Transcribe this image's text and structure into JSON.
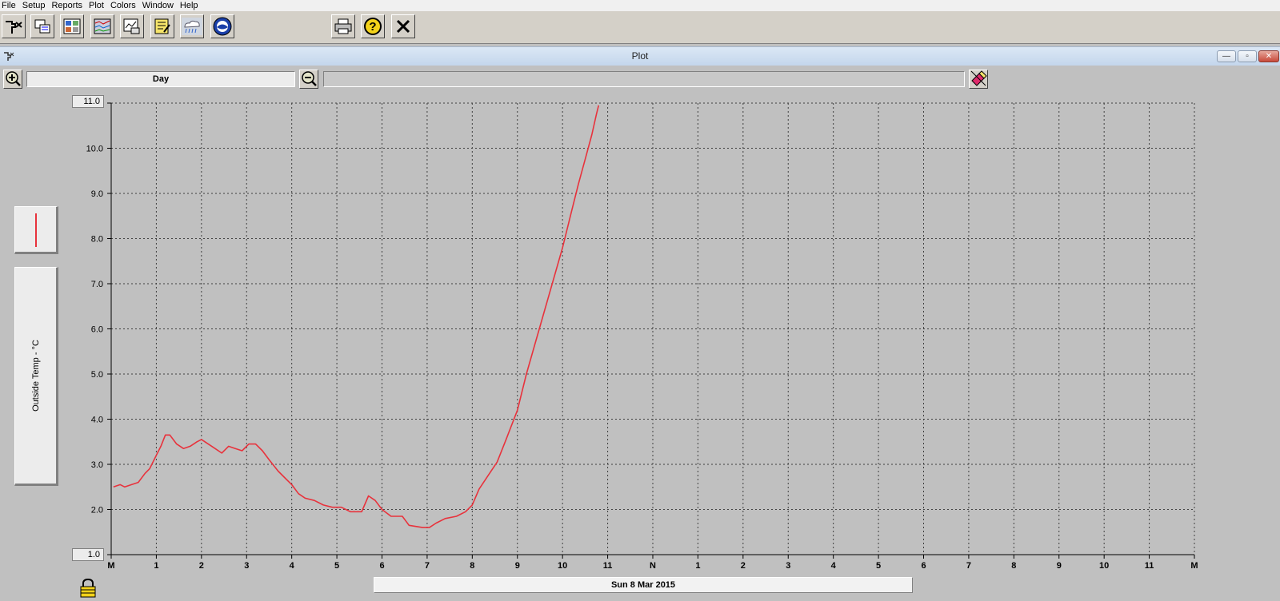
{
  "menu": {
    "items": [
      "File",
      "Setup",
      "Reports",
      "Plot",
      "Colors",
      "Window",
      "Help"
    ]
  },
  "toolbar": {
    "buttons": [
      {
        "icon": "walk-station-icon"
      },
      {
        "icon": "data-table-icon"
      },
      {
        "icon": "summary-grid-icon"
      },
      {
        "icon": "strip-chart-icon"
      },
      {
        "icon": "graph-icon"
      },
      {
        "icon": "notepad-icon"
      },
      {
        "icon": "weather-cloud-icon"
      },
      {
        "icon": "noaa-logo-icon"
      },
      {
        "icon": "printer-icon"
      },
      {
        "icon": "help-icon"
      },
      {
        "icon": "close-x-icon"
      }
    ]
  },
  "window": {
    "title": "Plot",
    "buttons": [
      "minimize",
      "restore",
      "close"
    ]
  },
  "zoom": {
    "span_label": "Day",
    "zoom_in_icon": "zoom-in-icon",
    "zoom_out_icon": "zoom-out-icon",
    "eraser_icon": "eraser-icon"
  },
  "legend": {
    "line_color": "#e8323c"
  },
  "colors": {
    "line": "#e8323c",
    "grid": "#404040",
    "background": "#c0c0c0"
  },
  "chart_data": {
    "type": "line",
    "ylabel": "Outside Temp - °C",
    "ylim": [
      1.0,
      11.0
    ],
    "yticks": [
      "11.0",
      "10.0",
      "9.0",
      "8.0",
      "7.0",
      "6.0",
      "5.0",
      "4.0",
      "3.0",
      "2.0",
      "1.0"
    ],
    "xlim": [
      0,
      24
    ],
    "xticks": [
      "M",
      "1",
      "2",
      "3",
      "4",
      "5",
      "6",
      "7",
      "8",
      "9",
      "10",
      "11",
      "N",
      "1",
      "2",
      "3",
      "4",
      "5",
      "6",
      "7",
      "8",
      "9",
      "10",
      "11",
      "M"
    ],
    "grid": true,
    "date_label": "Sun 8 Mar 2015",
    "series": [
      {
        "color": "#e8323c",
        "points": [
          [
            0.05,
            2.5
          ],
          [
            0.2,
            2.55
          ],
          [
            0.3,
            2.5
          ],
          [
            0.45,
            2.55
          ],
          [
            0.6,
            2.6
          ],
          [
            0.75,
            2.8
          ],
          [
            0.85,
            2.9
          ],
          [
            1.0,
            3.2
          ],
          [
            1.1,
            3.4
          ],
          [
            1.2,
            3.65
          ],
          [
            1.3,
            3.65
          ],
          [
            1.45,
            3.45
          ],
          [
            1.6,
            3.35
          ],
          [
            1.75,
            3.4
          ],
          [
            1.9,
            3.5
          ],
          [
            2.0,
            3.55
          ],
          [
            2.15,
            3.45
          ],
          [
            2.3,
            3.35
          ],
          [
            2.45,
            3.25
          ],
          [
            2.6,
            3.4
          ],
          [
            2.75,
            3.35
          ],
          [
            2.9,
            3.3
          ],
          [
            3.05,
            3.45
          ],
          [
            3.2,
            3.45
          ],
          [
            3.35,
            3.3
          ],
          [
            3.5,
            3.1
          ],
          [
            3.7,
            2.85
          ],
          [
            3.85,
            2.7
          ],
          [
            4.0,
            2.55
          ],
          [
            4.15,
            2.35
          ],
          [
            4.3,
            2.25
          ],
          [
            4.5,
            2.2
          ],
          [
            4.7,
            2.1
          ],
          [
            4.9,
            2.05
          ],
          [
            5.1,
            2.05
          ],
          [
            5.3,
            1.95
          ],
          [
            5.55,
            1.95
          ],
          [
            5.7,
            2.3
          ],
          [
            5.85,
            2.2
          ],
          [
            6.0,
            2.0
          ],
          [
            6.2,
            1.85
          ],
          [
            6.45,
            1.85
          ],
          [
            6.6,
            1.65
          ],
          [
            6.9,
            1.6
          ],
          [
            7.05,
            1.6
          ],
          [
            7.2,
            1.7
          ],
          [
            7.4,
            1.8
          ],
          [
            7.65,
            1.85
          ],
          [
            7.85,
            1.95
          ],
          [
            8.0,
            2.1
          ],
          [
            8.15,
            2.45
          ],
          [
            8.35,
            2.75
          ],
          [
            8.55,
            3.05
          ],
          [
            8.75,
            3.55
          ],
          [
            9.0,
            4.2
          ],
          [
            9.2,
            5.0
          ],
          [
            9.4,
            5.7
          ],
          [
            9.6,
            6.4
          ],
          [
            9.8,
            7.1
          ],
          [
            10.0,
            7.8
          ],
          [
            10.2,
            8.6
          ],
          [
            10.35,
            9.2
          ],
          [
            10.5,
            9.75
          ],
          [
            10.65,
            10.3
          ],
          [
            10.75,
            10.75
          ],
          [
            10.8,
            10.95
          ]
        ]
      }
    ]
  }
}
